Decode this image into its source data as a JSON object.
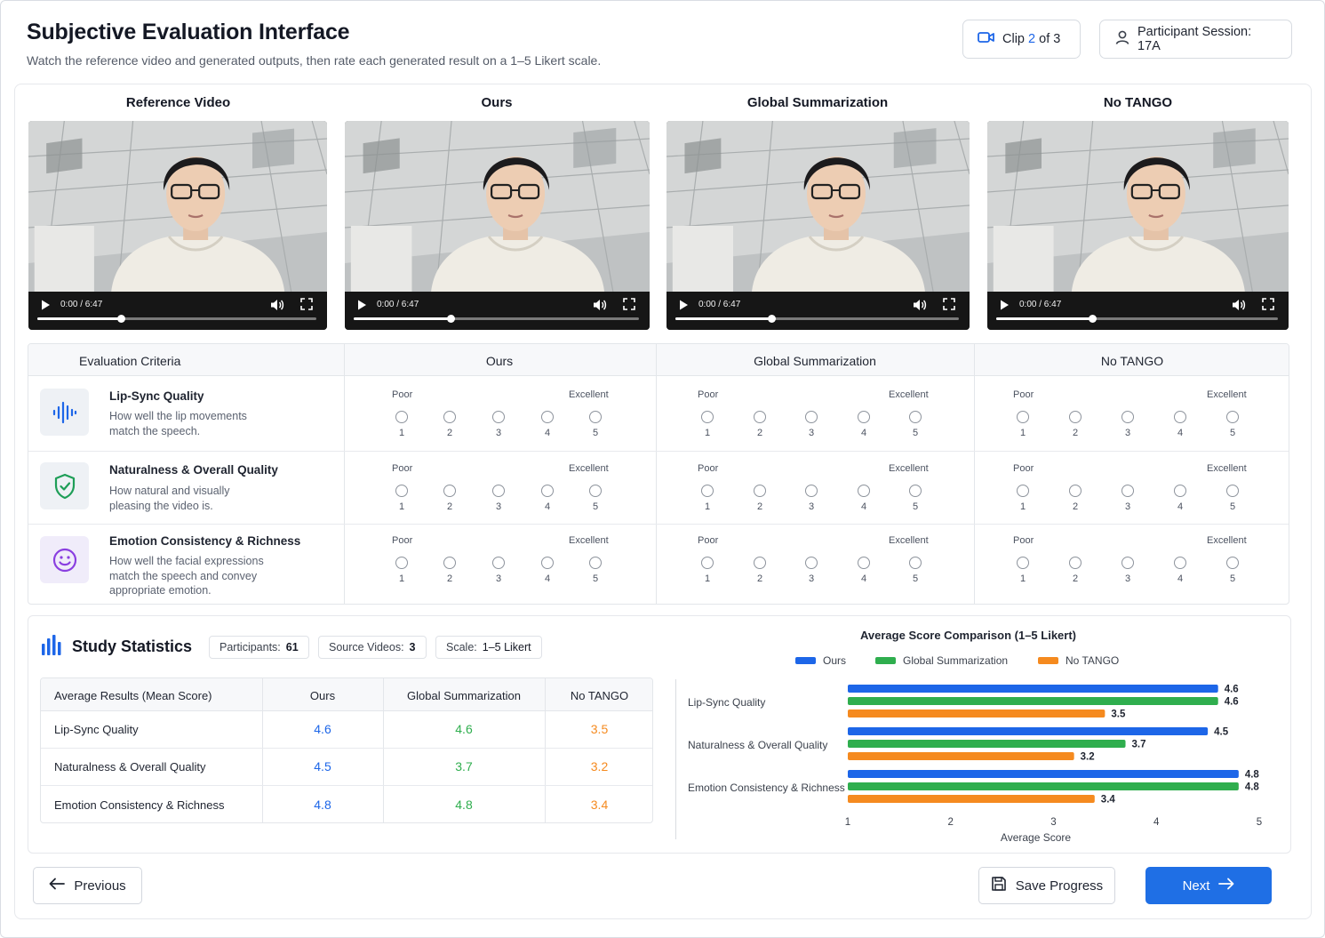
{
  "header": {
    "title": "Subjective Evaluation Interface",
    "subtitle": "Watch the reference video and generated outputs, then rate each generated result on a 1–5 Likert scale.",
    "clip_prefix": "Clip",
    "clip_current": "2",
    "clip_suffix": "of 3",
    "session": "Participant Session: 17A"
  },
  "videos": [
    {
      "title": "Reference Video",
      "time": "0:00 / 6:47",
      "progress": 0.3
    },
    {
      "title": "Ours",
      "time": "0:00 / 6:47",
      "progress": 0.34
    },
    {
      "title": "Global Summarization",
      "time": "0:00 / 6:47",
      "progress": 0.34
    },
    {
      "title": "No TANGO",
      "time": "0:00 / 6:47",
      "progress": 0.34
    }
  ],
  "evaluation": {
    "criteria_header": "Evaluation Criteria",
    "methods": [
      "Ours",
      "Global Summarization",
      "No TANGO"
    ],
    "poor_label": "Poor",
    "excellent_label": "Excellent",
    "scale": [
      "1",
      "2",
      "3",
      "4",
      "5"
    ],
    "criteria": [
      {
        "name": "Lip-Sync Quality",
        "description": "How well the lip movements match the speech.",
        "icon": "waveform-icon",
        "icon_color": "#1d66e8"
      },
      {
        "name": "Naturalness & Overall Quality",
        "description": "How natural and visually pleasing the video is.",
        "icon": "shield-check-icon",
        "icon_color": "#1e9e57"
      },
      {
        "name": "Emotion Consistency & Richness",
        "description": "How well the facial expressions match the speech and convey appropriate emotion.",
        "icon": "smiley-icon",
        "icon_color": "#8a3fe0"
      }
    ]
  },
  "stats": {
    "title": "Study Statistics",
    "participants_label": "Participants:",
    "participants": "61",
    "source_label": "Source Videos:",
    "source": "3",
    "scale_label": "Scale:",
    "scale": "1–5 Likert",
    "table": {
      "headers": [
        "Average Results (Mean Score)",
        "Ours",
        "Global Summarization",
        "No TANGO"
      ],
      "rows": [
        {
          "label": "Lip-Sync Quality",
          "values": [
            "4.6",
            "4.6",
            "3.5"
          ]
        },
        {
          "label": "Naturalness & Overall Quality",
          "values": [
            "4.5",
            "3.7",
            "3.2"
          ]
        },
        {
          "label": "Emotion Consistency & Richness",
          "values": [
            "4.8",
            "4.8",
            "3.4"
          ]
        }
      ]
    }
  },
  "colors": {
    "ours": "#1d66e8",
    "global": "#2fae4e",
    "notango": "#f58a1f",
    "primary": "#1f6fe5"
  },
  "chart_data": {
    "type": "bar",
    "orientation": "horizontal",
    "title": "Average Score Comparison (1–5 Likert)",
    "xlabel": "Average Score",
    "xlim": [
      1,
      5
    ],
    "xticks": [
      "1",
      "2",
      "3",
      "4",
      "5"
    ],
    "categories": [
      "Lip-Sync Quality",
      "Naturalness & Overall Quality",
      "Emotion Consistency & Richness"
    ],
    "series": [
      {
        "name": "Ours",
        "values": [
          4.6,
          4.5,
          4.8
        ],
        "color": "#1d66e8"
      },
      {
        "name": "Global Summarization",
        "values": [
          4.6,
          3.7,
          4.8
        ],
        "color": "#2fae4e"
      },
      {
        "name": "No TANGO",
        "values": [
          3.5,
          3.2,
          3.4
        ],
        "color": "#f58a1f"
      }
    ],
    "legend": "top"
  },
  "footer": {
    "previous": "Previous",
    "save": "Save Progress",
    "next": "Next"
  }
}
